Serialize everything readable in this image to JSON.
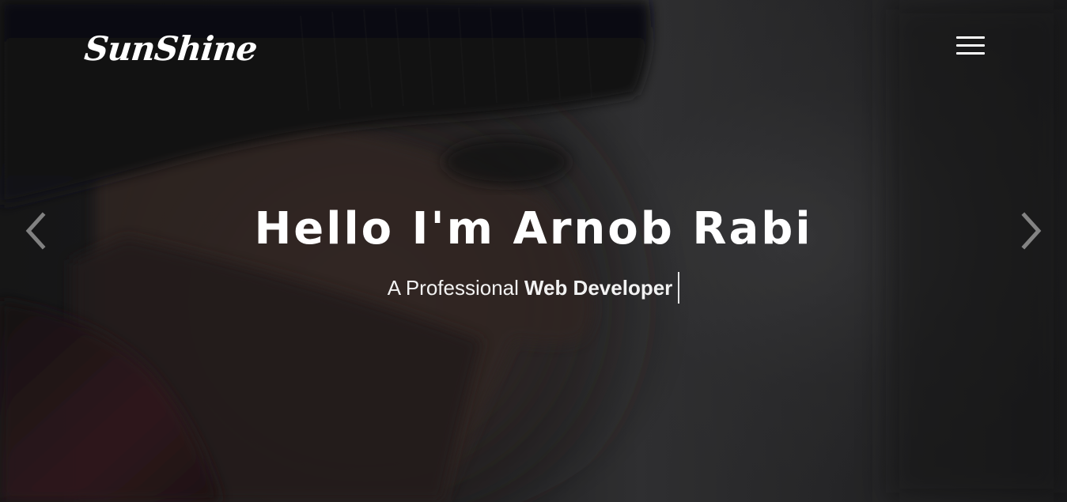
{
  "brand": {
    "logo_text": "SunShine"
  },
  "navigation": {
    "menu_icon": "hamburger-menu-icon"
  },
  "hero": {
    "title": "Hello I'm Arnob Rabi",
    "subtitle_prefix": "A Professional",
    "subtitle_highlight": "Web Developer",
    "prev_icon": "chevron-left-icon",
    "next_icon": "chevron-right-icon"
  },
  "colors": {
    "text": "#ffffff",
    "background_dark": "#1b1b1d",
    "background_mid": "#3a3a3c",
    "arrow": "#d9d9d9"
  }
}
